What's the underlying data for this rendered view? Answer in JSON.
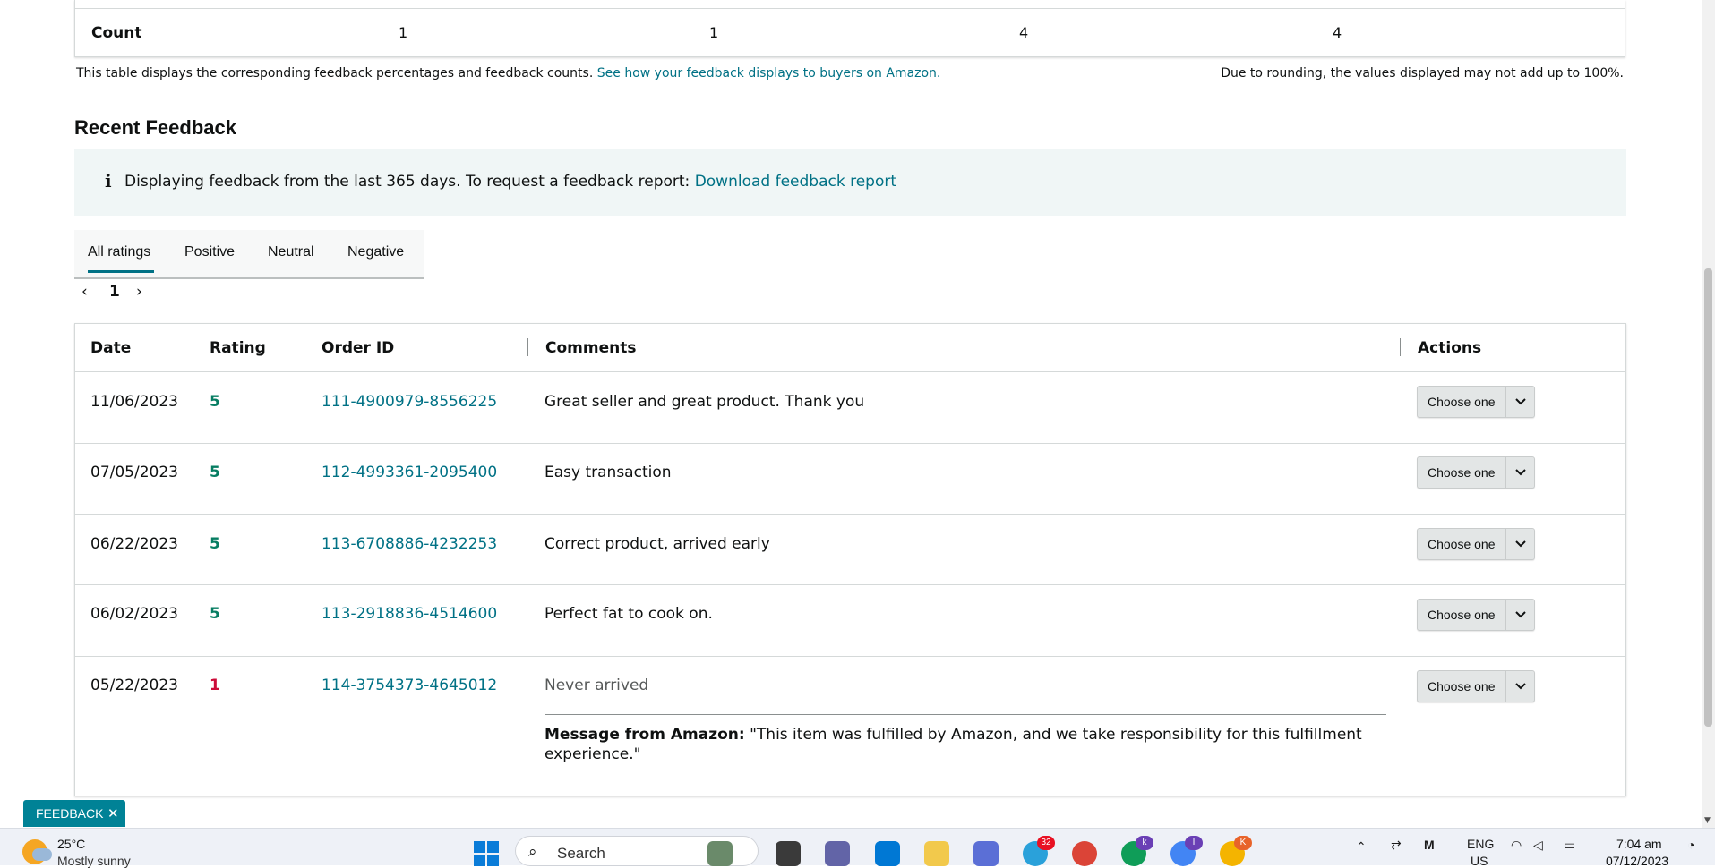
{
  "count_row": {
    "label": "Count",
    "values": [
      "1",
      "1",
      "4",
      "4"
    ]
  },
  "notes": {
    "left_text": "This table displays the corresponding feedback percentages and feedback counts.",
    "left_link": "See how your feedback displays to buyers on Amazon.",
    "right_text": "Due to rounding, the values displayed may not add up to 100%."
  },
  "recent": {
    "title": "Recent Feedback",
    "info_icon": "i",
    "info_text": "Displaying feedback from the last 365 days. To request a feedback report:",
    "info_link": "Download feedback report"
  },
  "tabs": [
    {
      "label": "All ratings",
      "active": true
    },
    {
      "label": "Positive"
    },
    {
      "label": "Neutral"
    },
    {
      "label": "Negative"
    }
  ],
  "pager": {
    "prev": "‹",
    "page": "1",
    "next": "›"
  },
  "table": {
    "headers": {
      "date": "Date",
      "rating": "Rating",
      "order_id": "Order ID",
      "comments": "Comments",
      "actions": "Actions"
    },
    "rows": [
      {
        "date": "11/06/2023",
        "rating": "5",
        "order_id": "111-4900979-8556225",
        "comment": "Great seller and great product. Thank you",
        "action": "Choose one"
      },
      {
        "date": "07/05/2023",
        "rating": "5",
        "order_id": "112-4993361-2095400",
        "comment": "Easy transaction",
        "action": "Choose one"
      },
      {
        "date": "06/22/2023",
        "rating": "5",
        "order_id": "113-6708886-4232253",
        "comment": "Correct product, arrived early",
        "action": "Choose one"
      },
      {
        "date": "06/02/2023",
        "rating": "5",
        "order_id": "113-2918836-4514600",
        "comment": "Perfect fat to cook on.",
        "action": "Choose one"
      },
      {
        "date": "05/22/2023",
        "rating": "1",
        "order_id": "114-3754373-4645012",
        "comment": "Never arrived",
        "action": "Choose one",
        "amazon_label": "Message from Amazon:",
        "amazon_message": "\"This item was fulfilled by Amazon, and we take responsibility for this fulfillment experience.\""
      }
    ]
  },
  "feedback_tab": {
    "label": "FEEDBACK",
    "close": "✕"
  },
  "taskbar": {
    "weather_temp": "25°C",
    "weather_desc": "Mostly sunny",
    "search_label": "Search",
    "telegram_badge": "32",
    "chrome_badges": [
      "k",
      "I",
      "K"
    ],
    "lang_top": "ENG",
    "lang_bottom": "US",
    "time": "7:04 am",
    "date": "07/12/2023"
  },
  "colors": {
    "link": "#007185",
    "positive": "#067d62",
    "negative": "#cc0c39",
    "banner_bg": "#f0f6f6",
    "feedback_tab": "#008296"
  }
}
